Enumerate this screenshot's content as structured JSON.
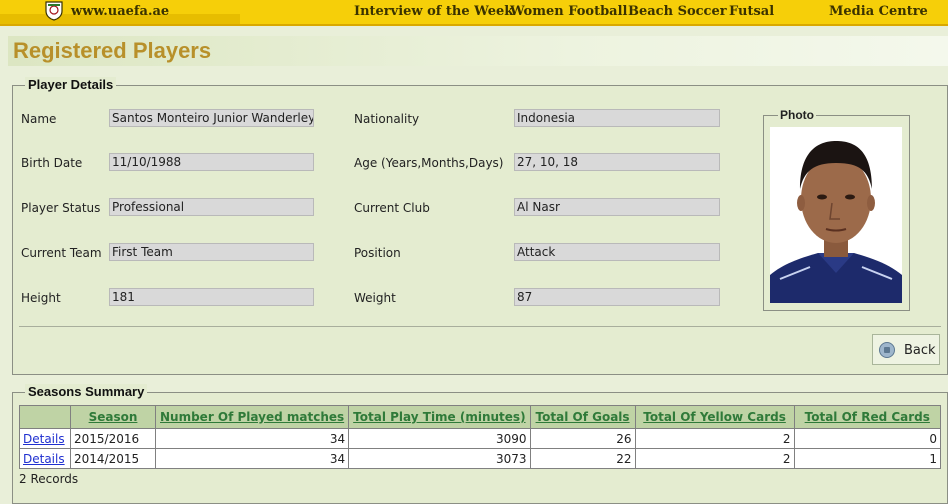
{
  "header": {
    "site": "www.uaefa.ae",
    "nav": [
      "Interview of the Week",
      "Women Football",
      "Beach Soccer",
      "Futsal",
      "Media Centre"
    ]
  },
  "page_title": "Registered Players",
  "player_details": {
    "legend": "Player Details",
    "name_label": "Name",
    "name": "Santos Monteiro Junior  Wanderley",
    "nationality_label": "Nationality",
    "nationality": "Indonesia",
    "birth_label": "Birth Date",
    "birth": "11/10/1988",
    "age_label": "Age (Years,Months,Days)",
    "age": "27, 10, 18",
    "status_label": "Player Status",
    "status": "Professional",
    "club_label": "Current Club",
    "club": "Al Nasr",
    "team_label": "Current Team",
    "team": "First Team",
    "position_label": "Position",
    "position": "Attack",
    "height_label": "Height",
    "height": "181",
    "weight_label": "Weight",
    "weight": "87",
    "photo_legend": "Photo",
    "back": "Back"
  },
  "seasons": {
    "legend": "Seasons Summary",
    "columns": [
      "",
      "Season",
      "Number Of Played matches",
      "Total Play Time (minutes)",
      "Total Of Goals",
      "Total Of Yellow Cards",
      "Total Of Red Cards"
    ],
    "rows": [
      {
        "link": "Details",
        "season": "2015/2016",
        "matches": "34",
        "minutes": "3090",
        "goals": "26",
        "yellow": "2",
        "red": "0"
      },
      {
        "link": "Details",
        "season": "2014/2015",
        "matches": "34",
        "minutes": "3073",
        "goals": "22",
        "yellow": "2",
        "red": "1"
      }
    ],
    "records": "2 Records"
  }
}
